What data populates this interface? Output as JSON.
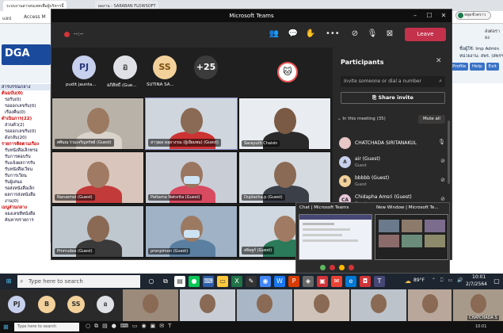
{
  "browser": {
    "tabs": [
      "ระบบงานสารสนเทศเพื่อผู้บริหารนี้",
      "ผลงาน - SARABAN FLOWSOFT"
    ],
    "bookmark_apps": "แอป",
    "bookmark_access": "Access M",
    "logo": "DGA",
    "user_label": "ชื่อผู้ใช้: Imp Admin",
    "org_label": "หน่วยงาน: สพร. (สพรฯ)",
    "profile_btn": "Profile",
    "help_btn": "Help",
    "exit_btn": "Exit",
    "top_right_label": "ส่งต่อรายง",
    "status_pill": "หยุดชั่วคราว",
    "left_menu": [
      {
        "text": "สารบรรณกลาง",
        "type": "head"
      },
      {
        "text": "ต้นฉบับ(0)",
        "type": "sec"
      },
      {
        "text": "รอรับ(0)",
        "type": "item"
      },
      {
        "text": "รอออกเลขรับ(0)",
        "type": "item"
      },
      {
        "text": "เรื่องคืน(0)",
        "type": "item"
      },
      {
        "text": "ดำเนินการ(22)",
        "type": "sec"
      },
      {
        "text": "ส่วนตัว(2)",
        "type": "item"
      },
      {
        "text": "รอออกเลขรับ(0)",
        "type": "item"
      },
      {
        "text": "ดังกลับ(20)",
        "type": "item"
      },
      {
        "text": "รายการติดตามเรื่อง",
        "type": "sec"
      },
      {
        "text": "รับหนังสือเล็กทรอ",
        "type": "item"
      },
      {
        "text": "รับการตอบรับ",
        "type": "item"
      },
      {
        "text": "รับแจ้งผลการรับ",
        "type": "item"
      },
      {
        "text": "รับหนังสือเวียน",
        "type": "item"
      },
      {
        "text": "รับการเวียน",
        "type": "item"
      },
      {
        "text": "รับผู้เสนอ",
        "type": "item"
      },
      {
        "text": "รอส่งหนังสือเล็ก",
        "type": "item"
      },
      {
        "text": "ผลการส่งหนังสือ",
        "type": "item"
      },
      {
        "text": "งาน(0)",
        "type": "item"
      },
      {
        "text": "เมนูส่วนกลาง",
        "type": "sec"
      },
      {
        "text": "จองเลขที่หนังสือ",
        "type": "item"
      },
      {
        "text": "ค้นหาขรายการ",
        "type": "item"
      }
    ]
  },
  "teams": {
    "title": "Microsoft Teams",
    "timer": "--:--",
    "leave_label": "Leave",
    "avatars": [
      {
        "initials": "PJ",
        "name": "pudit jaunta...",
        "bg": "#c7d0ec",
        "fg": "#2b3a7a"
      },
      {
        "initials": "อ",
        "name": "อภิสิทธิ์ (Gue...",
        "bg": "#dfe1e6",
        "fg": "#444"
      },
      {
        "initials": "SS",
        "name": "SUTINA SA...",
        "bg": "#f3d19b",
        "fg": "#7a4e10"
      },
      {
        "initials": "+25",
        "name": "",
        "bg": "#3b3b3b",
        "fg": "#ffffff"
      }
    ],
    "tiles": [
      {
        "label": "ศศิมณ ร่วมเจริญทรัพย์ (Guest)"
      },
      {
        "label": "สาวุฒล ดลุยางรณ (ผู้เยี่ยมชม) (Guest)"
      },
      {
        "label": "Sarayuth Chaisin"
      },
      {
        "label": "Naruemol (Guest)"
      },
      {
        "label": "Pattama Natsrita (Guest)"
      },
      {
        "label": "Dujdacha.p (Guest)"
      },
      {
        "label": "Pmrrudee (Guest)"
      },
      {
        "label": "pronpimon (Guest)"
      },
      {
        "label": "สจิ่มฐูก์ (Guest)"
      }
    ]
  },
  "participants": {
    "title": "Participants",
    "invite_placeholder": "Invite someone or dial a number",
    "share_invite": "Share invite",
    "in_meeting": "In this meeting (35)",
    "mute_all": "Mute all",
    "rows": [
      {
        "initials": "",
        "name": "CHATCHADA SIRITANAKUL",
        "role": "",
        "bg": "#e8c7c7"
      },
      {
        "initials": "A",
        "name": "air (Guest)",
        "role": "Guest",
        "bg": "#c7d0ec"
      },
      {
        "initials": "B",
        "name": "bbbbb (Guest)",
        "role": "Guest",
        "bg": "#f3d19b"
      },
      {
        "initials": "CA",
        "name": "Chidapha Amsri (Guest)",
        "role": "Guest",
        "bg": "#e8c7d9"
      }
    ]
  },
  "thumbs": {
    "left_title": "Chat | Microsoft Teams",
    "right_title": "New Window | Microsoft Te..."
  },
  "taskbar": {
    "search_placeholder": "Type here to search",
    "temp": "89°F",
    "time": "10:01",
    "date": "2/7/2564"
  },
  "lower_strip": {
    "avatars": [
      {
        "initials": "PJ",
        "bg": "#c7d0ec"
      },
      {
        "initials": "B",
        "bg": "#f3d19b"
      },
      {
        "initials": "SS",
        "bg": "#f3d19b"
      },
      {
        "initials": "อ",
        "bg": "#dfe1e6"
      }
    ],
    "bottom_label": "CHATCHADA S"
  }
}
